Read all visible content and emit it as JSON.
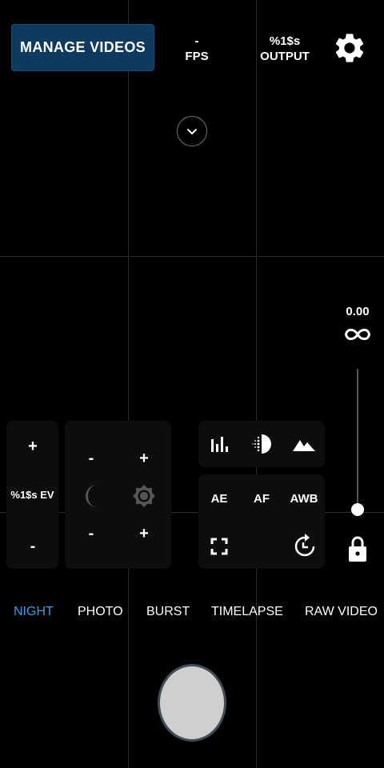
{
  "header": {
    "manage_videos_label": "MANAGE VIDEOS",
    "fps_value": "-",
    "fps_label": "FPS",
    "output_value": "%1$s",
    "output_label": "OUTPUT",
    "settings_icon": "gear-icon"
  },
  "controls": {
    "collapse_icon": "chevron-down-icon",
    "zoom_value": "0.00",
    "focus_icon": "infinity-icon",
    "focus_slider_level": 0.0,
    "lock_icon": "lock-icon"
  },
  "ev_panel": {
    "plus": "+",
    "value": "%1$s EV",
    "minus": "-"
  },
  "exposure_panel": {
    "night_minus_top": "-",
    "night_minus_bottom": "-",
    "day_plus_top": "+",
    "day_plus_bottom": "+",
    "night_icon": "moon-icon",
    "day_icon": "brightness-icon"
  },
  "mode_icons": {
    "histogram_icon": "histogram-icon",
    "hdr_icon": "hdr-icon",
    "landscape_icon": "landscape-icon"
  },
  "auto_panel": {
    "ae": "AE",
    "af": "AF",
    "awb": "AWB",
    "fullscreen_icon": "fullscreen-icon",
    "rotate_icon": "rotate-camera-icon"
  },
  "modes": [
    "NIGHT",
    "PHOTO",
    "BURST",
    "TIMELAPSE",
    "RAW VIDEO"
  ],
  "active_mode": "NIGHT",
  "colors": {
    "accent": "#3d9be0",
    "manage_button_bg": "#0d3a5e",
    "shutter": "#cfcfcf"
  }
}
